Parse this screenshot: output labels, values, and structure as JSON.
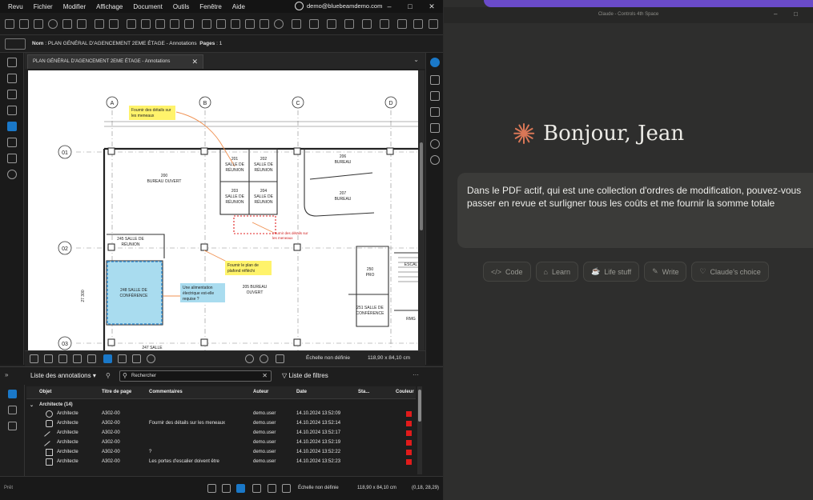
{
  "bluebeam": {
    "menu": [
      "Revu",
      "Fichier",
      "Modifier",
      "Affichage",
      "Document",
      "Outils",
      "Fenêtre",
      "Aide"
    ],
    "account": "demo@bluebeamdemo.com",
    "breadcrumb_prefix": "Nom",
    "breadcrumb": " : PLAN GÉNÉRAL D'AGENCEMENT 2EME ÉTAGE - Annotations",
    "pages_label": "Pages",
    "pages_value": " : 1",
    "doc_tab": "PLAN GÉNÉRAL D'AGENCEMENT 2EME ÉTAGE - Annotations",
    "drawing": {
      "grid_cols": [
        "A",
        "B",
        "C",
        "D"
      ],
      "grid_rows": [
        "01",
        "02",
        "03"
      ],
      "rooms": {
        "r200": "200",
        "r200b": "BUREAU OUVERT",
        "r201": "201",
        "r201b": "SALLE DE",
        "r201c": "RÉUNION",
        "r202": "202",
        "r202b": "SALLE DE",
        "r202c": "RÉUNION",
        "r203": "203",
        "r203b": "SALLE DE",
        "r203c": "RÉUNION",
        "r204": "204",
        "r204b": "SALLE DE",
        "r204c": "RÉUNION",
        "r206": "206",
        "r206b": "BUREAU",
        "r207": "207",
        "r207b": "BUREAU",
        "r245": "245 SALLE DE",
        "r245b": "RÉUNION",
        "r248": "248 SALLE DE",
        "r248b": "CONFÉRENCE",
        "r205": "205 BUREAU",
        "r205b": "OUVERT",
        "r250": "250",
        "r250b": "PRO",
        "r251": "251 SALLE DE",
        "r251b": "CONFÉRENCE",
        "esc": "ESCAL",
        "rmg": "RMG",
        "dim": "27 300",
        "r247": "247 SALLE"
      },
      "callouts": {
        "c1a": "Fournir des détails sur",
        "c1b": "les meneaux",
        "c2a": "Fournir des détails sur",
        "c2b": "les meneaux",
        "c3a": "Fournir le plan de",
        "c3b": "plafond réfléchi",
        "c4a": "Une alimentation",
        "c4b": "électrique est-elle",
        "c4c": "requise ?"
      }
    },
    "viewbar": {
      "scale_label": "Échelle non définie",
      "dimensions": "118,90 x 84,10 cm"
    },
    "annotations": {
      "title": "Liste des annotations ▾",
      "search_placeholder": "Rechercher",
      "filters_label": "Liste de filtres",
      "columns": [
        "Objet",
        "Titre de page",
        "Commentaires",
        "Auteur",
        "Date",
        "Sta...",
        "Couleur"
      ],
      "group": "Architecte (14)",
      "rows": [
        {
          "obj": "Architecte",
          "page": "A302-00",
          "comment": "",
          "author": "demo.user",
          "date": "14.10.2024 13:52:09"
        },
        {
          "obj": "Architecte",
          "page": "A302-00",
          "comment": "Fournir des détails sur les meneaux",
          "author": "demo.user",
          "date": "14.10.2024 13:52:14"
        },
        {
          "obj": "Architecte",
          "page": "A302-00",
          "comment": "",
          "author": "demo.user",
          "date": "14.10.2024 13:52:17"
        },
        {
          "obj": "Architecte",
          "page": "A302-00",
          "comment": "",
          "author": "demo.user",
          "date": "14.10.2024 13:52:19"
        },
        {
          "obj": "Architecte",
          "page": "A302-00",
          "comment": "?",
          "author": "demo.user",
          "date": "14.10.2024 13:52:22"
        },
        {
          "obj": "Architecte",
          "page": "A302-00",
          "comment": "Les portes d'escalier doivent être",
          "author": "demo.user",
          "date": "14.10.2024 13:52:23"
        }
      ]
    },
    "status": {
      "left": "Prêt",
      "scale_label": "Échelle non définie",
      "dimensions": "118,90 x 84,10 cm",
      "coords": "(0,18, 28,29)"
    }
  },
  "claude": {
    "window_title": "Claude - Controls 4th Space",
    "greeting": "Bonjour, Jean",
    "prompt": "Dans le PDF actif, qui est une collection d'ordres de modification, pouvez-vous passer en revue et surligner tous les coûts et me fournir la somme totale",
    "chips": [
      {
        "icon": "</>",
        "label": "Code"
      },
      {
        "icon": "⌂",
        "label": "Learn"
      },
      {
        "icon": "☕",
        "label": "Life stuff"
      },
      {
        "icon": "✎",
        "label": "Write"
      },
      {
        "icon": "♡",
        "label": "Claude's choice"
      }
    ],
    "accent": "#d97757"
  }
}
